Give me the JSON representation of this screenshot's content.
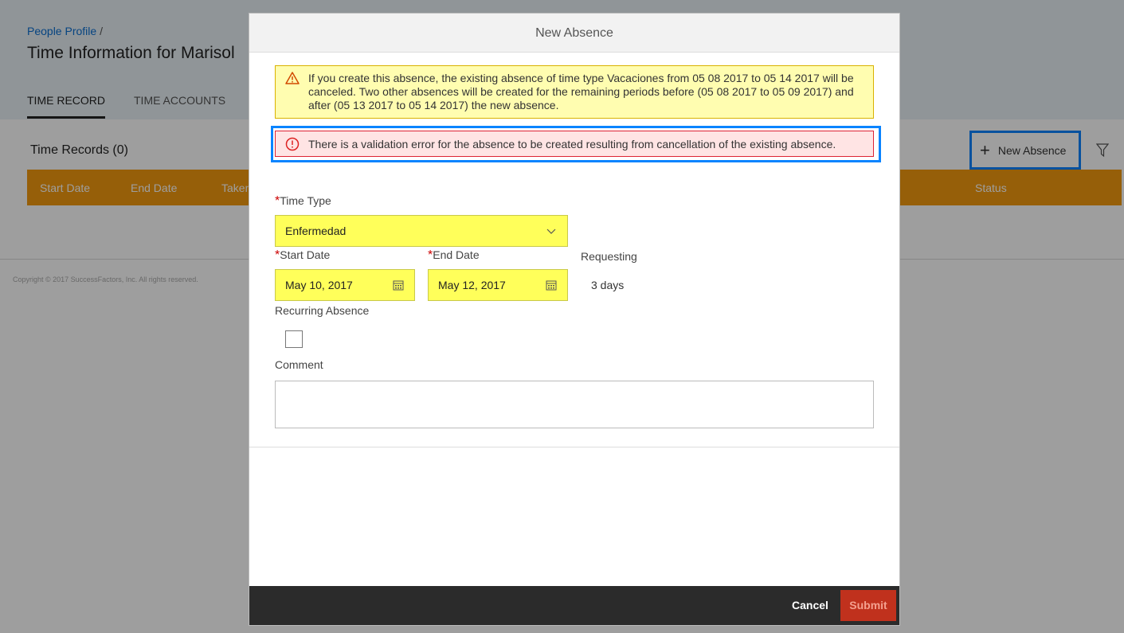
{
  "background": {
    "breadcrumb": "People Profile",
    "breadcrumb_sep": "/",
    "page_title": "Time Information for Marisol",
    "tabs": [
      {
        "label": "TIME RECORD",
        "active": true
      },
      {
        "label": "TIME ACCOUNTS",
        "active": false
      }
    ],
    "records_title": "Time Records (0)",
    "table_headers": [
      "Start Date",
      "End Date",
      "Taken",
      "Status"
    ],
    "new_absence_label": "New Absence",
    "new_absence_icon": "plus-icon",
    "filter_icon": "filter-icon",
    "copyright": "Copyright © 2017 SuccessFactors, Inc. All rights reserved.",
    "colors": {
      "accent": "#0a6ed1",
      "table_header": "#f29a0f"
    }
  },
  "dialog": {
    "title": "New Absence",
    "warning_text": "If you create this absence, the existing absence of time type Vacaciones from 05 08 2017 to 05 14 2017 will be canceled. Two other absences will be created for the remaining periods before (05 08 2017 to 05 09 2017) and after (05 13 2017 to 05 14 2017) the new absence.",
    "error_text": "There is a validation error for the absence to be created resulting from cancellation of the existing absence.",
    "time_type_label": "Time Type",
    "time_type_value": "Enfermedad",
    "start_date_label": "Start Date",
    "start_date_value": "May 10, 2017",
    "end_date_label": "End Date",
    "end_date_value": "May 12, 2017",
    "requesting_label": "Requesting",
    "requesting_value": "3 days",
    "recurring_label": "Recurring Absence",
    "recurring_checked": false,
    "comment_label": "Comment",
    "comment_value": "",
    "cancel_label": "Cancel",
    "submit_label": "Submit",
    "colors": {
      "field_highlight": "#ffff5a",
      "warning_bg": "#fffdb0",
      "error_bg": "#ffe4e4",
      "submit": "#c0311d"
    }
  }
}
